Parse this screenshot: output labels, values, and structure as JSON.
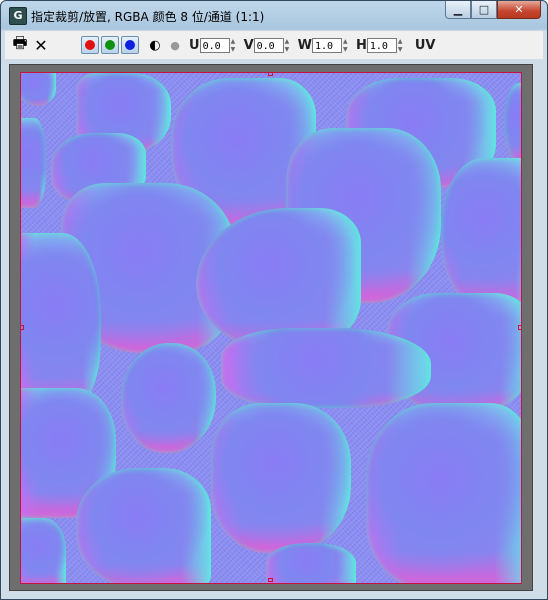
{
  "window": {
    "title": "指定裁剪/放置, RGBA 颜色 8 位/通道 (1:1)",
    "app_icon_letter": "G",
    "buttons": {
      "minimize": "▁",
      "maximize": "□",
      "close": "✕"
    }
  },
  "toolbar": {
    "print_icon": "🖶",
    "clear_icon": "✕",
    "channels": [
      {
        "name": "red",
        "color": "#e01010"
      },
      {
        "name": "green",
        "color": "#109010"
      },
      {
        "name": "blue",
        "color": "#1020e0"
      }
    ],
    "mono_icon": "◐",
    "alpha_icon": "●",
    "u_label": "U",
    "u_value": "0.0",
    "v_label": "V",
    "v_value": "0.0",
    "w_label": "W",
    "w_value": "1.0",
    "h_label": "H",
    "h_value": "1.0",
    "uv_label": "UV"
  },
  "canvas": {
    "border_color": "#c8143c",
    "content": "normal-map stone texture"
  }
}
